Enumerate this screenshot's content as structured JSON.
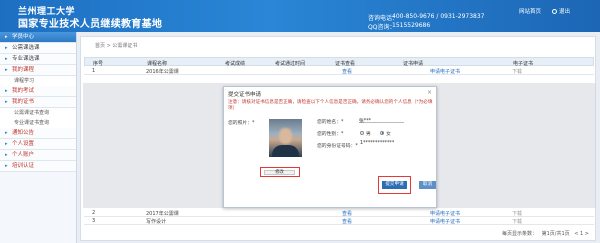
{
  "header": {
    "logo_line1": "兰州理工大学",
    "logo_line2": "国家专业技术人员继续教育基地",
    "hotline_label": "咨询电话：",
    "hotline": "400-850-9676 / 0931-2973837",
    "qq_label": "QQ咨询：",
    "qq": "1515529686",
    "home_link": "网站首页",
    "exit_link": "退出"
  },
  "sidebar": {
    "items": [
      {
        "label": "学员中心",
        "style": "active"
      },
      {
        "label": "公需课选课",
        "style": "normal"
      },
      {
        "label": "专业课选课",
        "style": "normal"
      },
      {
        "label": "我的课程",
        "style": "red"
      },
      {
        "label": "课程学习",
        "style": "sub"
      },
      {
        "label": "我的考试",
        "style": "red"
      },
      {
        "label": "我的证书",
        "style": "red"
      },
      {
        "label": "公需课证书查询",
        "style": "sub"
      },
      {
        "label": "专业课证书查询",
        "style": "sub"
      },
      {
        "label": "通知公告",
        "style": "red"
      },
      {
        "label": "个人设置",
        "style": "red"
      },
      {
        "label": "个人账户",
        "style": "red"
      },
      {
        "label": "培训认证",
        "style": "red"
      }
    ]
  },
  "main": {
    "breadcrumb": "首页 > 公需课证书",
    "table": {
      "headers": [
        "序号",
        "课程名称",
        "考试成绩",
        "考试通过时间",
        "证书查看",
        "证书申请",
        "电子证书"
      ],
      "rows": [
        {
          "no": "1",
          "name": "2016年公需课",
          "score": "",
          "time": "",
          "view": "查看",
          "apply": "申请电子证书",
          "cert": "下载"
        },
        {
          "no": "2",
          "name": "2017年公需课",
          "score": "",
          "time": "",
          "view": "查看",
          "apply": "申请电子证书",
          "cert": "下载"
        },
        {
          "no": "3",
          "name": "写作设计",
          "score": "",
          "time": "",
          "view": "查看",
          "apply": "申请电子证书",
          "cert": "下载"
        }
      ]
    },
    "pager": {
      "total": "每页显示条数：",
      "page": "第1页/共1页",
      "nav": "< 1 >"
    }
  },
  "dialog": {
    "title": "提交证书申请",
    "close": "×",
    "note": "注意：请核对证书信息是否正确，请检查以下个人信息是否正确，请务必确认您的个人信息（*为必填项）",
    "photo_label": "您的照片：*",
    "upload_label": "修改",
    "name_label": "您的姓名：*",
    "name_value": "张***",
    "gender_label": "您的性别：*",
    "gender_male": "男",
    "gender_female": "女",
    "gender_selected": "female",
    "id_label": "您的身份证号码：*",
    "id_value": "1*************",
    "submit_label": "提交申请",
    "cancel_label": "取消"
  }
}
